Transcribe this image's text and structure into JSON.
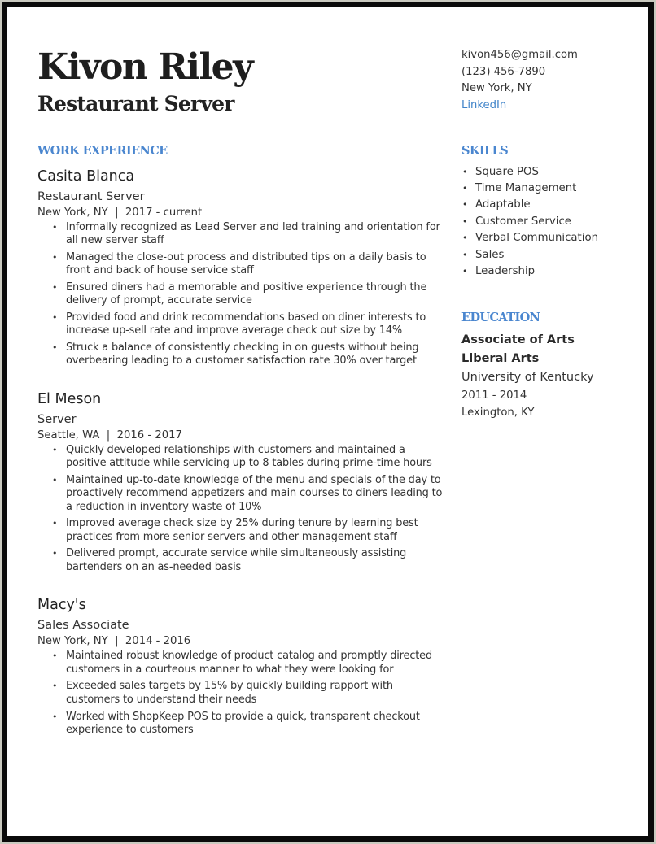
{
  "header": {
    "name": "Kivon Riley",
    "title": "Restaurant Server"
  },
  "contact": {
    "email": "kivon456@gmail.com",
    "phone": "(123) 456-7890",
    "location": "New York, NY",
    "linkedin": "LinkedIn"
  },
  "colors": {
    "accent": "#4a86cf",
    "link": "#3f83c9",
    "text": "#333333",
    "frame": "#0a0a0a"
  },
  "work": {
    "heading": "WORK EXPERIENCE",
    "jobs": [
      {
        "company": "Casita Blanca",
        "role": "Restaurant Server",
        "location": "New York, NY",
        "dates": "2017 - current",
        "bullets": [
          "Informally recognized as Lead Server and led training and orientation for all new server staff",
          "Managed the close-out process and distributed tips on a daily basis to front and back of house service staff",
          "Ensured diners had a memorable and positive experience through the delivery of prompt, accurate service",
          "Provided food and drink recommendations based on diner interests to increase up-sell rate and improve average check out size by 14%",
          "Struck a balance of consistently checking in on guests without being overbearing leading to a customer satisfaction rate 30% over target"
        ]
      },
      {
        "company": "El Meson",
        "role": "Server",
        "location": "Seattle, WA",
        "dates": "2016 - 2017",
        "bullets": [
          "Quickly developed relationships with customers and maintained a positive attitude while servicing up to 8 tables during prime-time hours",
          "Maintained up-to-date knowledge of the menu and specials of the day to proactively recommend appetizers and main courses to diners leading to a reduction in inventory waste of 10%",
          "Improved average check size by 25% during tenure by learning best practices from more senior servers and other management staff",
          "Delivered prompt, accurate service while simultaneously assisting bartenders on an as-needed basis"
        ]
      },
      {
        "company": "Macy's",
        "role": "Sales Associate",
        "location": "New York, NY",
        "dates": "2014 - 2016",
        "bullets": [
          "Maintained robust knowledge of product catalog and promptly directed customers in a courteous manner to what they were looking for",
          "Exceeded sales targets by 15% by quickly building rapport with customers to understand their needs",
          "Worked with ShopKeep POS to provide a quick, transparent checkout experience to customers"
        ]
      }
    ]
  },
  "skills": {
    "heading": "SKILLS",
    "items": [
      "Square POS",
      "Time Management",
      "Adaptable",
      "Customer Service",
      "Verbal Communication",
      "Sales",
      "Leadership"
    ]
  },
  "education": {
    "heading": "EDUCATION",
    "degree": "Associate of Arts",
    "major": "Liberal Arts",
    "school": "University of Kentucky",
    "dates": "2011 - 2014",
    "location": "Lexington, KY"
  }
}
